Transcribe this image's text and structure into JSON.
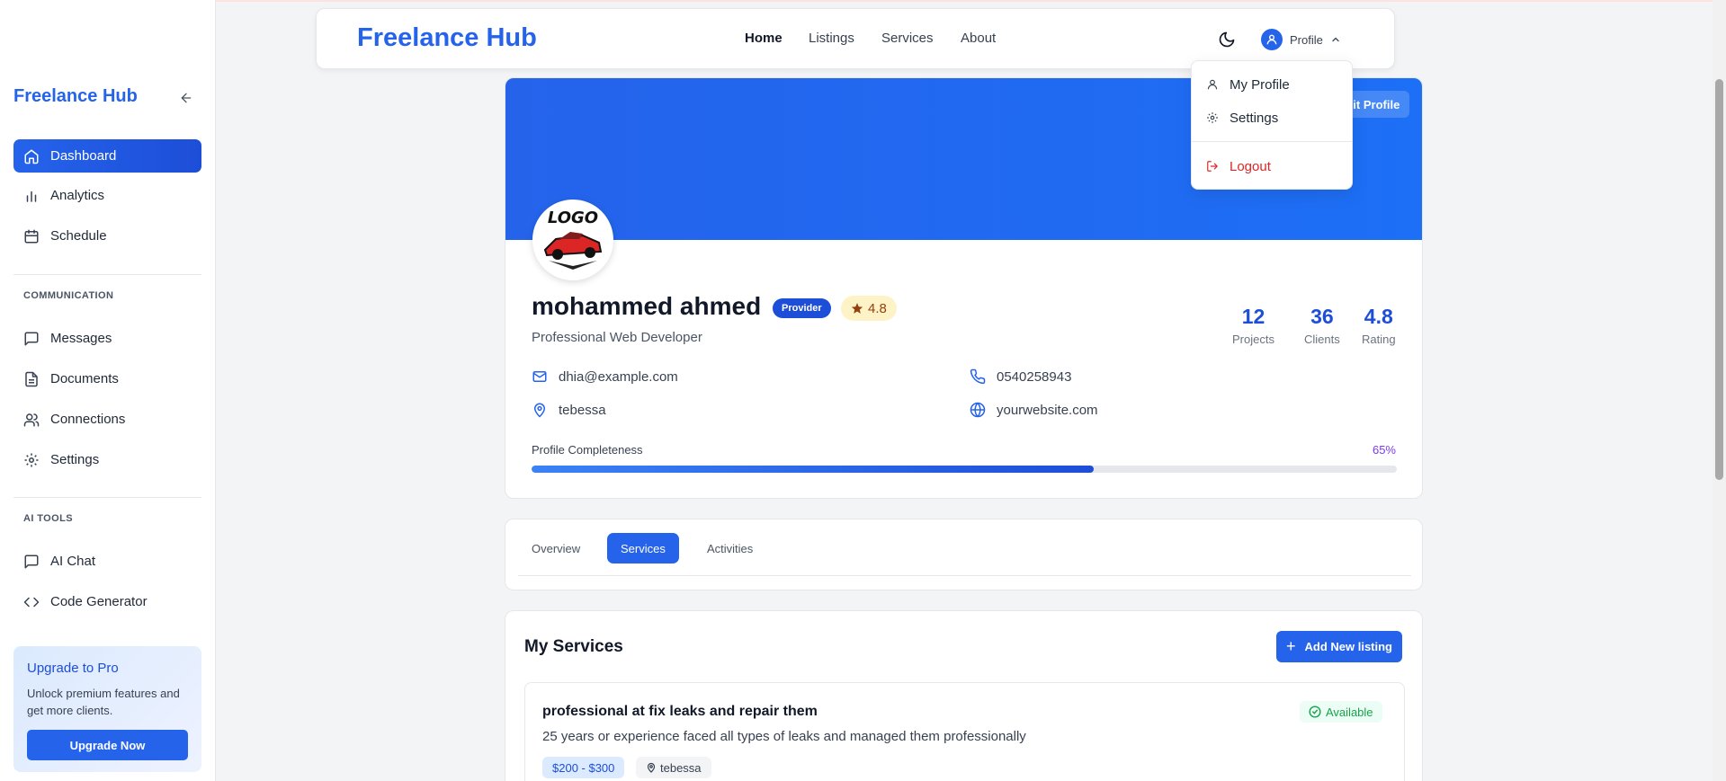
{
  "sidebar": {
    "brand": "Freelance Hub",
    "items_main": [
      {
        "label": "Dashboard",
        "icon": "home-icon"
      },
      {
        "label": "Analytics",
        "icon": "bar-chart-icon"
      },
      {
        "label": "Schedule",
        "icon": "calendar-icon"
      }
    ],
    "section_communication": "COMMUNICATION",
    "items_communication": [
      {
        "label": "Messages",
        "icon": "message-icon"
      },
      {
        "label": "Documents",
        "icon": "document-icon"
      },
      {
        "label": "Connections",
        "icon": "users-icon"
      },
      {
        "label": "Settings",
        "icon": "gear-icon"
      }
    ],
    "section_ai": "AI TOOLS",
    "items_ai": [
      {
        "label": "AI Chat",
        "icon": "message-icon"
      },
      {
        "label": "Code Generator",
        "icon": "code-icon"
      }
    ],
    "upgrade": {
      "title": "Upgrade to Pro",
      "text": "Unlock premium features and get more clients.",
      "button": "Upgrade Now"
    }
  },
  "topnav": {
    "brand": "Freelance Hub",
    "links": [
      "Home",
      "Listings",
      "Services",
      "About"
    ],
    "active_link": "Home",
    "profile_label": "Profile"
  },
  "dropdown": {
    "items": [
      "My Profile",
      "Settings"
    ],
    "logout": "Logout"
  },
  "profile": {
    "edit_button": "Edit Profile",
    "name": "mohammed ahmed",
    "role_badge": "Provider",
    "rating_badge": "4.8",
    "title": "Professional Web Developer",
    "stats": [
      {
        "value": "12",
        "label": "Projects"
      },
      {
        "value": "36",
        "label": "Clients"
      },
      {
        "value": "4.8",
        "label": "Rating"
      }
    ],
    "email": "dhia@example.com",
    "phone": "0540258943",
    "location": "tebessa",
    "website": "yourwebsite.com",
    "completeness_label": "Profile Completeness",
    "completeness_text": "65%",
    "completeness_value": 0.65,
    "avatar_text": "LOGO"
  },
  "tabs": {
    "items": [
      "Overview",
      "Services",
      "Activities"
    ],
    "active": "Services"
  },
  "services": {
    "title": "My Services",
    "add_button": "Add New listing",
    "list": [
      {
        "title": "professional at fix leaks and repair them",
        "status": "Available",
        "description": "25 years or experience faced all types of leaks and managed them professionally",
        "price": "$200 - $300",
        "location": "tebessa"
      }
    ]
  },
  "colors": {
    "accent": "#2563eb",
    "success": "#16a34a",
    "danger": "#dc2626",
    "rating_bg": "#fef3c7"
  }
}
